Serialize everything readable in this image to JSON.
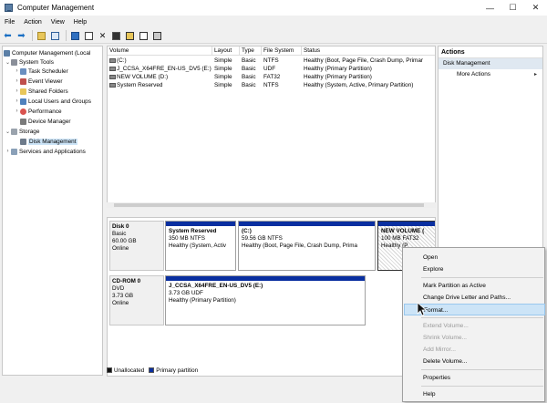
{
  "window": {
    "title": "Computer Management",
    "controls": {
      "minimize": "—",
      "maximize": "☐",
      "close": "✕"
    }
  },
  "menu": [
    "File",
    "Action",
    "View",
    "Help"
  ],
  "tree": {
    "root": "Computer Management (Local",
    "system_tools": "System Tools",
    "task_scheduler": "Task Scheduler",
    "event_viewer": "Event Viewer",
    "shared_folders": "Shared Folders",
    "local_users": "Local Users and Groups",
    "performance": "Performance",
    "device_manager": "Device Manager",
    "storage": "Storage",
    "disk_management": "Disk Management",
    "services": "Services and Applications"
  },
  "volume_list": {
    "columns": [
      "Volume",
      "Layout",
      "Type",
      "File System",
      "Status"
    ],
    "rows": [
      [
        "(C:)",
        "Simple",
        "Basic",
        "NTFS",
        "Healthy (Boot, Page File, Crash Dump, Primar"
      ],
      [
        "J_CCSA_X64FRE_EN-US_DV5 (E:)",
        "Simple",
        "Basic",
        "UDF",
        "Healthy (Primary Partition)"
      ],
      [
        "NEW VOLUME (D:)",
        "Simple",
        "Basic",
        "FAT32",
        "Healthy (Primary Partition)"
      ],
      [
        "System Reserved",
        "Simple",
        "Basic",
        "NTFS",
        "Healthy (System, Active, Primary Partition)"
      ]
    ]
  },
  "disks": {
    "disk0": {
      "name": "Disk 0",
      "type": "Basic",
      "size": "60.00 GB",
      "status": "Online",
      "partitions": [
        {
          "name": "System Reserved",
          "size": "350 MB NTFS",
          "status": "Healthy (System, Activ"
        },
        {
          "name": "(C:)",
          "size": "59.56 GB NTFS",
          "status": "Healthy (Boot, Page File, Crash Dump, Prima"
        },
        {
          "name": "NEW VOLUME (",
          "size": "100 MB FAT32",
          "status": "Healthy (P"
        }
      ]
    },
    "cdrom0": {
      "name": "CD-ROM 0",
      "type": "DVD",
      "size": "3.73 GB",
      "status": "Online",
      "partition": {
        "name": "J_CCSA_X64FRE_EN-US_DV5 (E:)",
        "size": "3.73 GB UDF",
        "status": "Healthy (Primary Partition)"
      }
    }
  },
  "legend": {
    "unallocated": "Unallocated",
    "primary": "Primary partition"
  },
  "actions": {
    "header": "Actions",
    "section": "Disk Management",
    "more": "More Actions"
  },
  "context_menu": {
    "open": "Open",
    "explore": "Explore",
    "mark_active": "Mark Partition as Active",
    "change_letter": "Change Drive Letter and Paths...",
    "format": "Format...",
    "extend": "Extend Volume...",
    "shrink": "Shrink Volume...",
    "add_mirror": "Add Mirror...",
    "delete": "Delete Volume...",
    "properties": "Properties",
    "help": "Help"
  },
  "colors": {
    "primary_partition": "#0a2fa0",
    "selection": "#cce4f7"
  }
}
